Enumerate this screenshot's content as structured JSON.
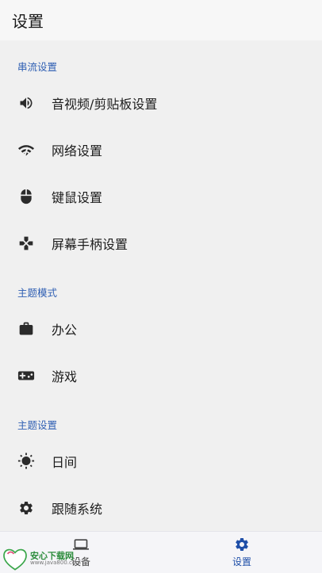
{
  "appbar": {
    "title": "设置"
  },
  "sections": {
    "streaming": {
      "header": "串流设置",
      "items": [
        {
          "label": "音视频/剪贴板设置",
          "icon": "volume-icon"
        },
        {
          "label": "网络设置",
          "icon": "wifi-signal-icon"
        },
        {
          "label": "键鼠设置",
          "icon": "mouse-icon"
        },
        {
          "label": "屏幕手柄设置",
          "icon": "gamepad-dpad-icon"
        }
      ]
    },
    "theme_mode": {
      "header": "主题模式",
      "items": [
        {
          "label": "办公",
          "icon": "briefcase-icon"
        },
        {
          "label": "游戏",
          "icon": "gamepad-icon"
        }
      ]
    },
    "theme_settings": {
      "header": "主题设置",
      "items": [
        {
          "label": "日间",
          "icon": "sun-icon"
        },
        {
          "label": "跟随系统",
          "icon": "gear-icon"
        }
      ]
    }
  },
  "bottom_nav": {
    "items": [
      {
        "label": "设备",
        "icon": "monitor-icon",
        "active": false
      },
      {
        "label": "设置",
        "icon": "gear-icon",
        "active": true
      }
    ],
    "active_color": "#1f4fa8"
  },
  "watermark": {
    "name": "安心下载网",
    "url": "www.java800.com",
    "logo_text": "安心 下载"
  },
  "colors": {
    "accent": "#2f5fb3",
    "background": "#f0f0f0",
    "icon": "#2b2b2b"
  }
}
